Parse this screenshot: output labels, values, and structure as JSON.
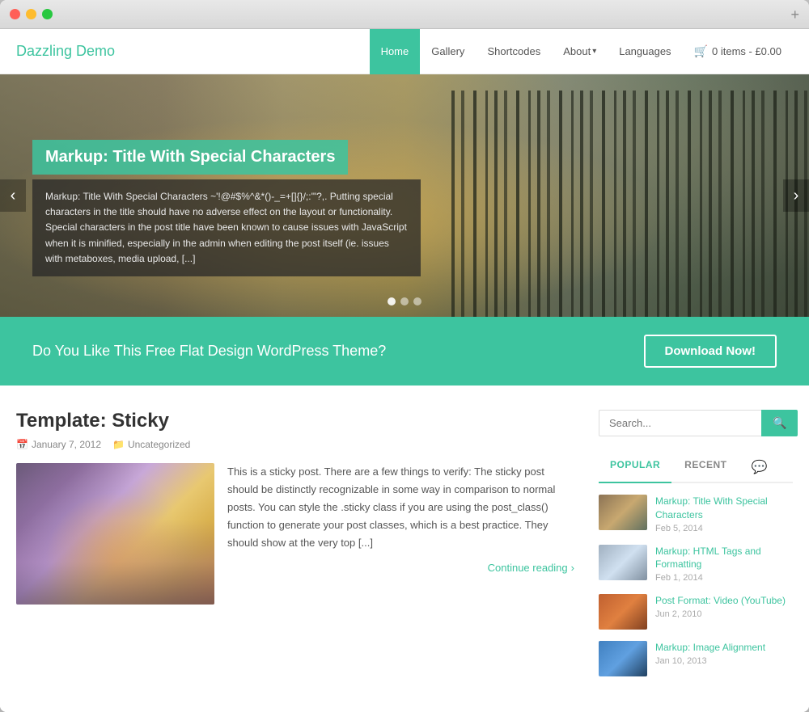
{
  "browser": {
    "plus_label": "+"
  },
  "header": {
    "logo": "Dazzling Demo",
    "nav_items": [
      {
        "label": "Home",
        "active": true
      },
      {
        "label": "Gallery",
        "active": false
      },
      {
        "label": "Shortcodes",
        "active": false
      },
      {
        "label": "About",
        "active": false,
        "has_dropdown": true
      },
      {
        "label": "Languages",
        "active": false
      },
      {
        "label": "0 items - £0.00",
        "active": false,
        "is_cart": true
      }
    ]
  },
  "hero": {
    "title": "Markup: Title With Special Characters",
    "text": "Markup: Title With Special Characters ~'!@#$%^&*()-_=+[]{}/;:'\"?,. Putting special characters in the title should have no adverse effect on the layout or functionality. Special characters in the post title have been known to cause issues with JavaScript when it is minified, especially in the admin when editing the post itself (ie. issues with metaboxes, media upload, [...]",
    "dots": [
      {
        "active": true
      },
      {
        "active": false
      },
      {
        "active": false
      }
    ]
  },
  "cta": {
    "text": "Do You Like This Free Flat Design WordPress Theme?",
    "button_label": "Download Now!"
  },
  "article": {
    "title": "Template: Sticky",
    "meta_date": "January 7, 2012",
    "meta_category": "Uncategorized",
    "text": "This is a sticky post. There are a few things to verify: The sticky post should be distinctly recognizable in some way in comparison to normal posts. You can style the .sticky class if you are using the post_class() function to generate your post classes, which is a best practice. They should show at the very top [...]",
    "continue_label": "Continue reading"
  },
  "sidebar": {
    "search_placeholder": "Search...",
    "tabs": [
      {
        "label": "POPULAR",
        "active": true
      },
      {
        "label": "RECENT",
        "active": false
      },
      {
        "label": "💬",
        "active": false,
        "is_icon": true
      }
    ],
    "popular_items": [
      {
        "title": "Markup: Title With Special Characters",
        "date": "Feb 5, 2014",
        "thumb_class": "thumb-1"
      },
      {
        "title": "Markup: HTML Tags and Formatting",
        "date": "Feb 1, 2014",
        "thumb_class": "thumb-2"
      },
      {
        "title": "Post Format: Video (YouTube)",
        "date": "Jun 2, 2010",
        "thumb_class": "thumb-3"
      },
      {
        "title": "Markup: Image Alignment",
        "date": "Jan 10, 2013",
        "thumb_class": "thumb-4"
      }
    ]
  }
}
